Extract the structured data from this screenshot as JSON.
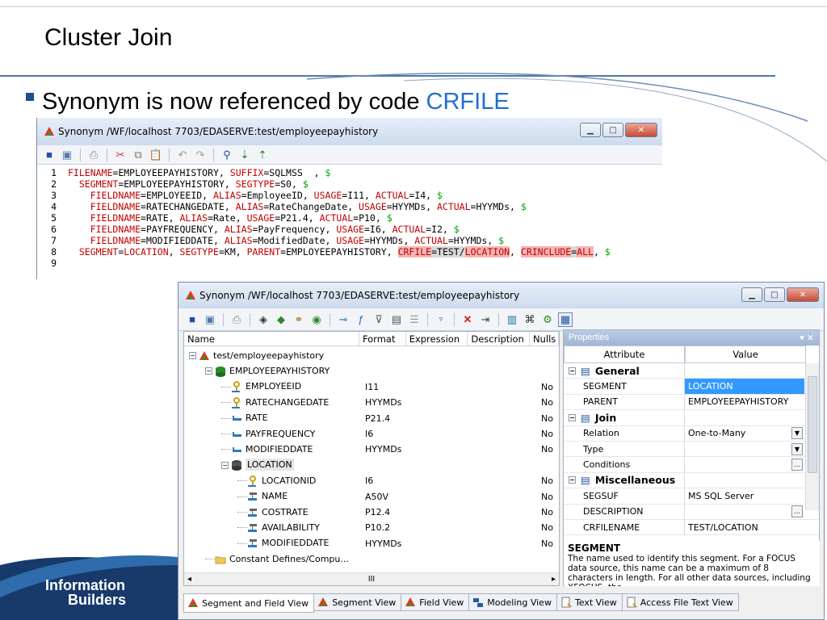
{
  "slide": {
    "title": "Cluster Join",
    "bullet_text": "Synonym is now referenced by code ",
    "bullet_code": "CRFILE",
    "logo_line1": "Information",
    "logo_line2": "Builders"
  },
  "window1": {
    "title": "Synonym /WF/localhost 7703/EDASERVE:test/employeepayhistory",
    "lines": [
      {
        "n": "1",
        "indent": "",
        "segs": [
          [
            "kw",
            "FILENAME"
          ],
          [
            "op",
            "=EMPLOYEEPAYHISTORY, "
          ],
          [
            "kw",
            "SUFFIX"
          ],
          [
            "op",
            "=SQLMSS  , "
          ],
          [
            "dl",
            "$"
          ]
        ]
      },
      {
        "n": "2",
        "indent": "  ",
        "segs": [
          [
            "kw",
            "SEGMENT"
          ],
          [
            "op",
            "=EMPLOYEEPAYHISTORY, "
          ],
          [
            "kw",
            "SEGTYPE"
          ],
          [
            "op",
            "=S0, "
          ],
          [
            "dl",
            "$"
          ]
        ]
      },
      {
        "n": "3",
        "indent": "    ",
        "segs": [
          [
            "kw",
            "FIELDNAME"
          ],
          [
            "op",
            "=EMPLOYEEID, "
          ],
          [
            "kw",
            "ALIAS"
          ],
          [
            "op",
            "=EmployeeID, "
          ],
          [
            "kw",
            "USAGE"
          ],
          [
            "op",
            "=I11, "
          ],
          [
            "kw",
            "ACTUAL"
          ],
          [
            "op",
            "=I4, "
          ],
          [
            "dl",
            "$"
          ]
        ]
      },
      {
        "n": "4",
        "indent": "    ",
        "segs": [
          [
            "kw",
            "FIELDNAME"
          ],
          [
            "op",
            "=RATECHANGEDATE, "
          ],
          [
            "kw",
            "ALIAS"
          ],
          [
            "op",
            "=RateChangeDate, "
          ],
          [
            "kw",
            "USAGE"
          ],
          [
            "op",
            "=HYYMDs, "
          ],
          [
            "kw",
            "ACTUAL"
          ],
          [
            "op",
            "=HYYMDs, "
          ],
          [
            "dl",
            "$"
          ]
        ]
      },
      {
        "n": "5",
        "indent": "    ",
        "segs": [
          [
            "kw",
            "FIELDNAME"
          ],
          [
            "op",
            "=RATE, "
          ],
          [
            "kw",
            "ALIAS"
          ],
          [
            "op",
            "=Rate, "
          ],
          [
            "kw",
            "USAGE"
          ],
          [
            "op",
            "=P21.4, "
          ],
          [
            "kw",
            "ACTUAL"
          ],
          [
            "op",
            "=P10, "
          ],
          [
            "dl",
            "$"
          ]
        ]
      },
      {
        "n": "6",
        "indent": "    ",
        "segs": [
          [
            "kw",
            "FIELDNAME"
          ],
          [
            "op",
            "=PAYFREQUENCY, "
          ],
          [
            "kw",
            "ALIAS"
          ],
          [
            "op",
            "=PayFrequency, "
          ],
          [
            "kw",
            "USAGE"
          ],
          [
            "op",
            "=I6, "
          ],
          [
            "kw",
            "ACTUAL"
          ],
          [
            "op",
            "=I2, "
          ],
          [
            "dl",
            "$"
          ]
        ]
      },
      {
        "n": "7",
        "indent": "    ",
        "segs": [
          [
            "kw",
            "FIELDNAME"
          ],
          [
            "op",
            "=MODIFIEDDATE, "
          ],
          [
            "kw",
            "ALIAS"
          ],
          [
            "op",
            "=ModifiedDate, "
          ],
          [
            "kw",
            "USAGE"
          ],
          [
            "op",
            "=HYYMDs, "
          ],
          [
            "kw",
            "ACTUAL"
          ],
          [
            "op",
            "=HYYMDs, "
          ],
          [
            "dl",
            "$"
          ]
        ]
      },
      {
        "n": "8",
        "indent": "  ",
        "segs": [
          [
            "kw",
            "SEGMENT"
          ],
          [
            "op",
            "="
          ],
          [
            "kw",
            "LOCATION"
          ],
          [
            "op",
            ", "
          ],
          [
            "kw",
            "SEGTYPE"
          ],
          [
            "op",
            "=KM, "
          ],
          [
            "kw",
            "PARENT"
          ],
          [
            "op",
            "=EMPLOYEEPAYHISTORY, "
          ],
          [
            "hlkw",
            "CRFILE"
          ],
          [
            "hlop",
            "=TEST/"
          ],
          [
            "hlkw",
            "LOCATION"
          ],
          [
            "op",
            ", "
          ],
          [
            "hlkw",
            "CRINCLUDE"
          ],
          [
            "hlop",
            "="
          ],
          [
            "hlkw",
            "ALL"
          ],
          [
            "op",
            ", "
          ],
          [
            "dl",
            "$"
          ]
        ]
      },
      {
        "n": "9",
        "indent": "",
        "segs": []
      }
    ]
  },
  "window2": {
    "title": "Synonym /WF/localhost 7703/EDASERVE:test/employeepayhistory",
    "tree_headers": {
      "name": "Name",
      "format": "Format",
      "expression": "Expression",
      "description": "Description",
      "nulls": "Nulls"
    },
    "tree_rows": [
      {
        "name": "test/employeepayhistory",
        "format": "",
        "nulls": "",
        "level": 0,
        "icon": "synonym-icon",
        "expander": "⊟"
      },
      {
        "name": "EMPLOYEEPAYHISTORY",
        "format": "",
        "nulls": "",
        "level": 1,
        "icon": "segment-icon",
        "expander": "⊟"
      },
      {
        "name": "EMPLOYEEID",
        "format": "I11",
        "nulls": "No",
        "level": 2,
        "icon": "key-field-icon",
        "expander": ""
      },
      {
        "name": "RATECHANGEDATE",
        "format": "HYYMDs",
        "nulls": "No",
        "level": 2,
        "icon": "key-field-icon",
        "expander": ""
      },
      {
        "name": "RATE",
        "format": "P21.4",
        "nulls": "No",
        "level": 2,
        "icon": "field-icon",
        "expander": ""
      },
      {
        "name": "PAYFREQUENCY",
        "format": "I6",
        "nulls": "No",
        "level": 2,
        "icon": "field-icon",
        "expander": ""
      },
      {
        "name": "MODIFIEDDATE",
        "format": "HYYMDs",
        "nulls": "No",
        "level": 2,
        "icon": "field-icon",
        "expander": ""
      },
      {
        "name": "LOCATION",
        "format": "",
        "nulls": "",
        "level": 2,
        "icon": "cluster-segment-icon",
        "expander": "⊟"
      },
      {
        "name": "LOCATIONID",
        "format": "I6",
        "nulls": "No",
        "level": 3,
        "icon": "key-field-icon",
        "expander": ""
      },
      {
        "name": "NAME",
        "format": "A50V",
        "nulls": "No",
        "level": 3,
        "icon": "cluster-field-icon",
        "expander": ""
      },
      {
        "name": "COSTRATE",
        "format": "P12.4",
        "nulls": "No",
        "level": 3,
        "icon": "cluster-field-icon",
        "expander": ""
      },
      {
        "name": "AVAILABILITY",
        "format": "P10.2",
        "nulls": "No",
        "level": 3,
        "icon": "cluster-field-icon",
        "expander": ""
      },
      {
        "name": "MODIFIEDDATE",
        "format": "HYYMDs",
        "nulls": "No",
        "level": 3,
        "icon": "cluster-field-icon",
        "expander": ""
      },
      {
        "name": "Constant Defines/Compu...",
        "format": "",
        "nulls": "",
        "level": 1,
        "icon": "folder-icon",
        "expander": ""
      }
    ],
    "properties": {
      "title": "Properties",
      "title_controls": "▾ ✕",
      "col_attribute": "Attribute",
      "col_value": "Value",
      "rows": [
        {
          "type": "cat",
          "attr": "General",
          "value": ""
        },
        {
          "type": "row",
          "attr": "SEGMENT",
          "value": "LOCATION",
          "selected": true
        },
        {
          "type": "row",
          "attr": "PARENT",
          "value": "EMPLOYEEPAYHISTORY"
        },
        {
          "type": "cat",
          "attr": "Join",
          "value": ""
        },
        {
          "type": "row",
          "attr": "Relation",
          "value": "One-to-Many",
          "control": "dropdown"
        },
        {
          "type": "row",
          "attr": "Type",
          "value": "",
          "control": "dropdown"
        },
        {
          "type": "row",
          "attr": "Conditions",
          "value": "",
          "control": "ellipsis"
        },
        {
          "type": "cat",
          "attr": "Miscellaneous",
          "value": ""
        },
        {
          "type": "row",
          "attr": "SEGSUF",
          "value": "MS SQL Server"
        },
        {
          "type": "row",
          "attr": "DESCRIPTION",
          "value": "",
          "control": "ellipsis"
        },
        {
          "type": "row",
          "attr": "CRFILENAME",
          "value": "TEST/LOCATION"
        }
      ],
      "help_title": "SEGMENT",
      "help_text": "The name used to identify this segment. For a FOCUS data source, this name can be a maximum of 8 characters in length. For all other data sources, including XFOCUS, the"
    },
    "scroll_thumb": "III",
    "tabs": [
      {
        "label": "Segment and Field View",
        "icon": "synonym-icon"
      },
      {
        "label": "Segment View",
        "icon": "synonym-icon"
      },
      {
        "label": "Field View",
        "icon": "synonym-icon"
      },
      {
        "label": "Modeling View",
        "icon": "modeling-icon"
      },
      {
        "label": "Text View",
        "icon": "text-icon"
      },
      {
        "label": "Access File Text View",
        "icon": "text-icon"
      }
    ]
  }
}
